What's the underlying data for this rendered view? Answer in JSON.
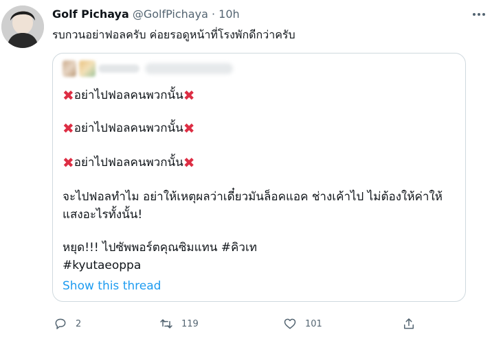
{
  "tweet": {
    "author_name": "Golf Pichaya",
    "handle": "@GolfPichaya",
    "separator": "·",
    "time": "10h",
    "text": "รบกวนอย่าฟอลครับ ค่อยรอดูหน้าที่โรงพักดีกว่าครับ"
  },
  "quote": {
    "lines": [
      "อย่าไปฟอลคนพวกนั้น",
      "อย่าไปฟอลคนพวกนั้น",
      "อย่าไปฟอลคนพวกนั้น"
    ],
    "paragraph_line1": "จะไปฟอลทำไม อย่าให้เหตุผลว่าเดี๋ยวมันล็อคแอค ช่างเค้าไป ไม่ต้องให้ค่าให้",
    "paragraph_line2": "แสงอะไรทั้งนั้น!",
    "last_line1": "หยุด!!! ไปซัพพอร์ตคุณซิมแทน #คิวเท",
    "last_line2": "#kyutaeoppa",
    "show_thread": "Show this thread"
  },
  "actions": {
    "replies": "2",
    "retweets": "119",
    "likes": "101"
  },
  "icons": {
    "more": "more-icon",
    "reply": "reply-icon",
    "retweet": "retweet-icon",
    "like": "heart-icon",
    "share": "share-icon",
    "cross": "cross-mark-icon"
  },
  "colors": {
    "accent": "#1d9bf0",
    "cross": "#dd2e44",
    "muted": "#536471"
  }
}
